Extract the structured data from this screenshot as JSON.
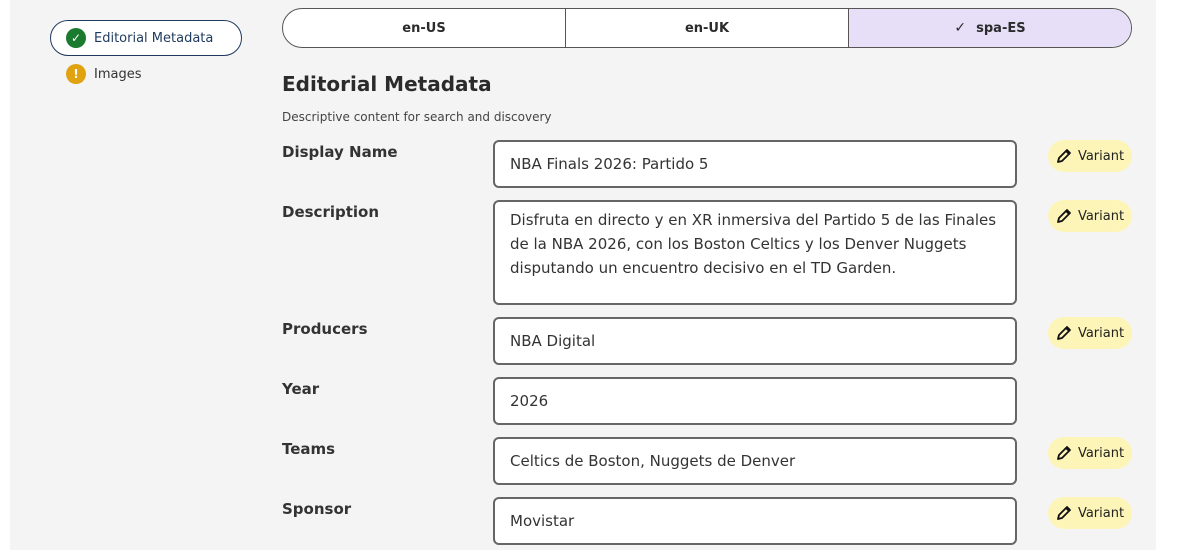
{
  "sidebar": {
    "items": [
      {
        "label": "Editorial Metadata",
        "status": "complete"
      },
      {
        "label": "Images",
        "status": "warning"
      }
    ]
  },
  "locale_tabs": [
    {
      "label": "en-US",
      "selected": false
    },
    {
      "label": "en-UK",
      "selected": false
    },
    {
      "label": "spa-ES",
      "selected": true
    }
  ],
  "section": {
    "title": "Editorial Metadata",
    "subtitle": "Descriptive content for search and discovery"
  },
  "fields": [
    {
      "label": "Display Name",
      "value": "NBA Finals 2026: Partido 5",
      "variant": "Variant"
    },
    {
      "label": "Description",
      "value": "Disfruta en directo y en XR inmersiva del Partido 5 de las Finales de la NBA 2026, con los Boston Celtics y los Denver Nuggets disputando un encuentro decisivo en el TD Garden.",
      "variant": "Variant"
    },
    {
      "label": "Producers",
      "value": "NBA Digital",
      "variant": "Variant"
    },
    {
      "label": "Year",
      "value": "2026",
      "variant": ""
    },
    {
      "label": "Teams",
      "value": "Celtics de Boston, Nuggets de Denver",
      "variant": "Variant"
    },
    {
      "label": "Sponsor",
      "value": "Movistar",
      "variant": "Variant"
    }
  ],
  "colors": {
    "selected_tab": "#e6dff7",
    "variant_badge": "#fdf5b7",
    "status_complete": "#1a7a2e",
    "status_warning": "#e0a20f"
  },
  "icons": {
    "complete": "check-circle-icon",
    "warning": "exclamation-circle-icon",
    "selected_tab": "check-icon",
    "variant": "pencil-icon"
  }
}
